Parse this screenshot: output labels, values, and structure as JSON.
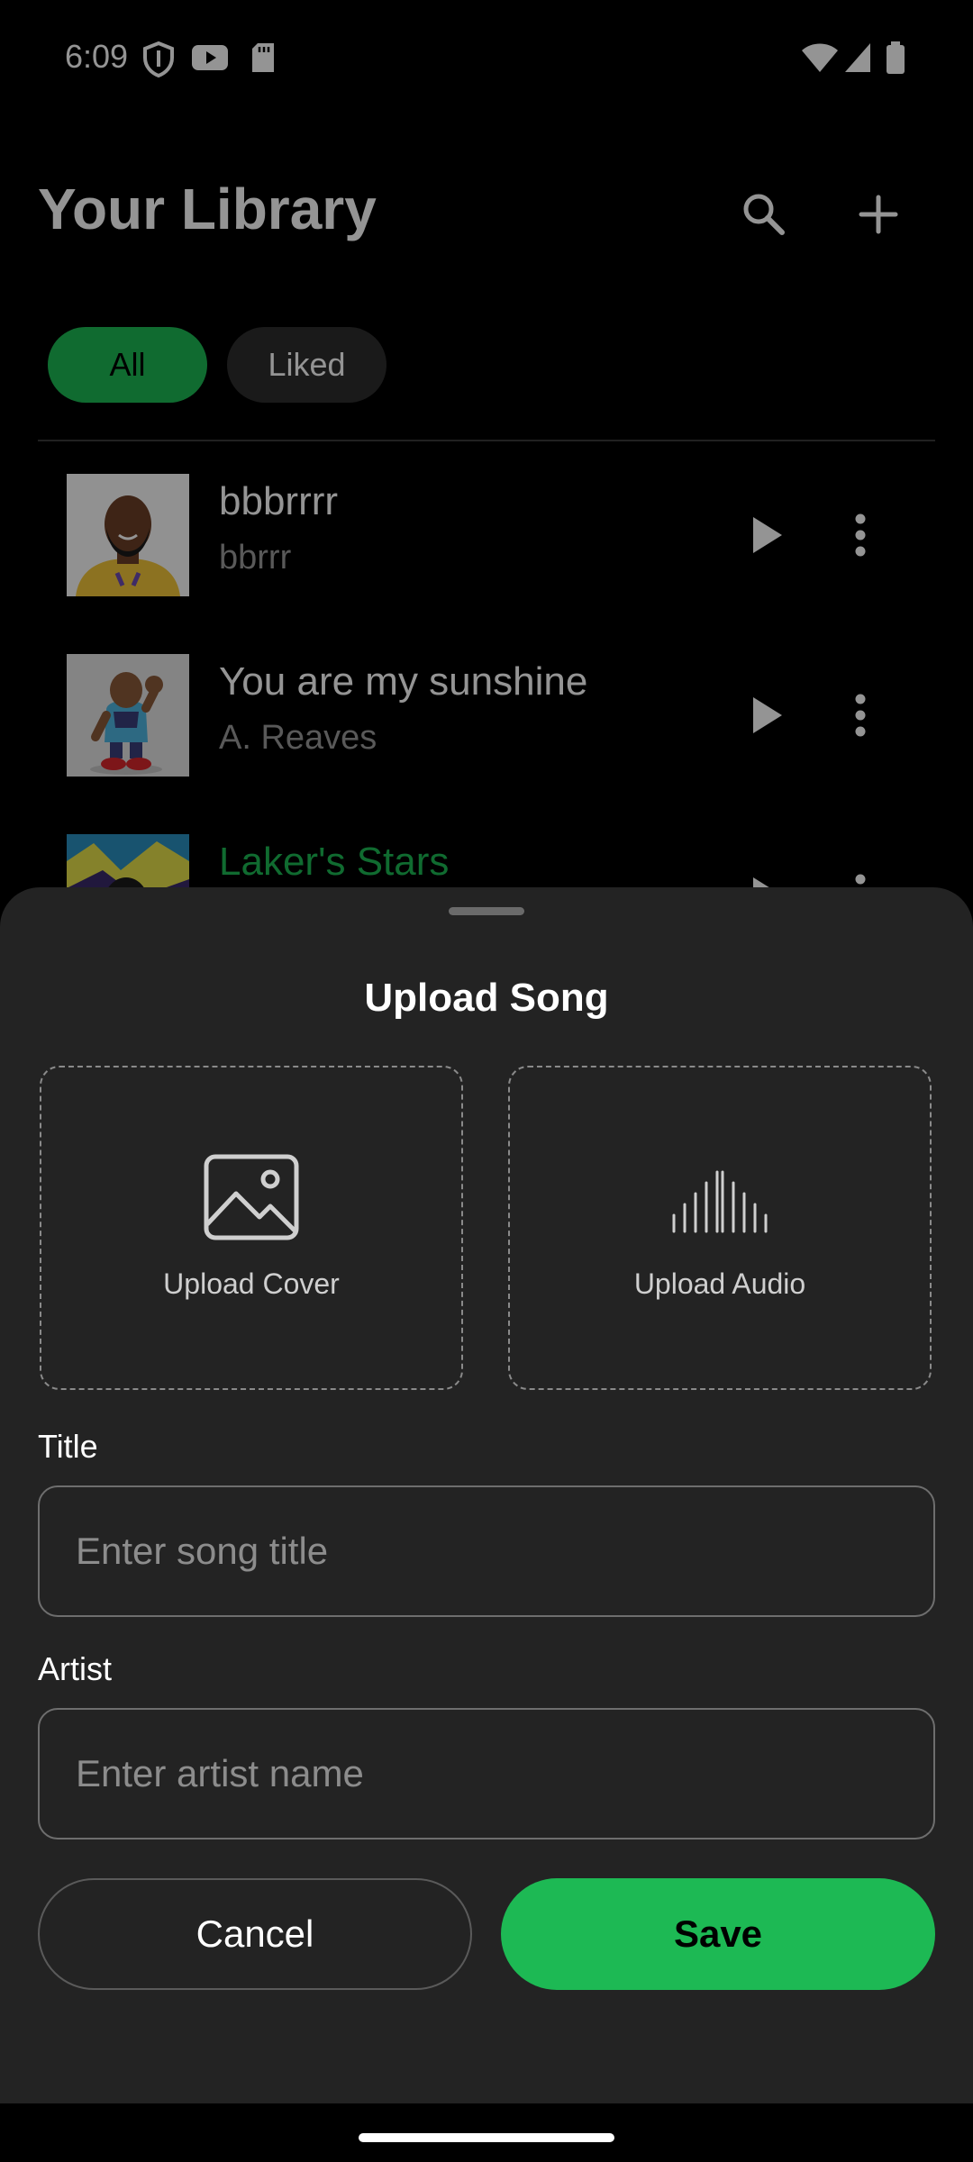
{
  "status_bar": {
    "time": "6:09"
  },
  "library": {
    "title": "Your Library",
    "filters": [
      "All",
      "Liked"
    ],
    "active_filter": "All",
    "songs": [
      {
        "title": "bbbrrrr",
        "artist": "bbrrr",
        "title_color": "#ffffff"
      },
      {
        "title": "You are my sunshine",
        "artist": "A. Reaves",
        "title_color": "#ffffff"
      },
      {
        "title": "Laker's Stars",
        "artist": "",
        "title_color": "#1db954"
      }
    ]
  },
  "sheet": {
    "title": "Upload Song",
    "upload_cover_label": "Upload Cover",
    "upload_audio_label": "Upload Audio",
    "title_label": "Title",
    "title_placeholder": "Enter song title",
    "artist_label": "Artist",
    "artist_placeholder": "Enter artist name",
    "cancel_label": "Cancel",
    "save_label": "Save"
  },
  "colors": {
    "accent": "#1db954",
    "sheet_bg": "#232323",
    "background": "#000000"
  }
}
